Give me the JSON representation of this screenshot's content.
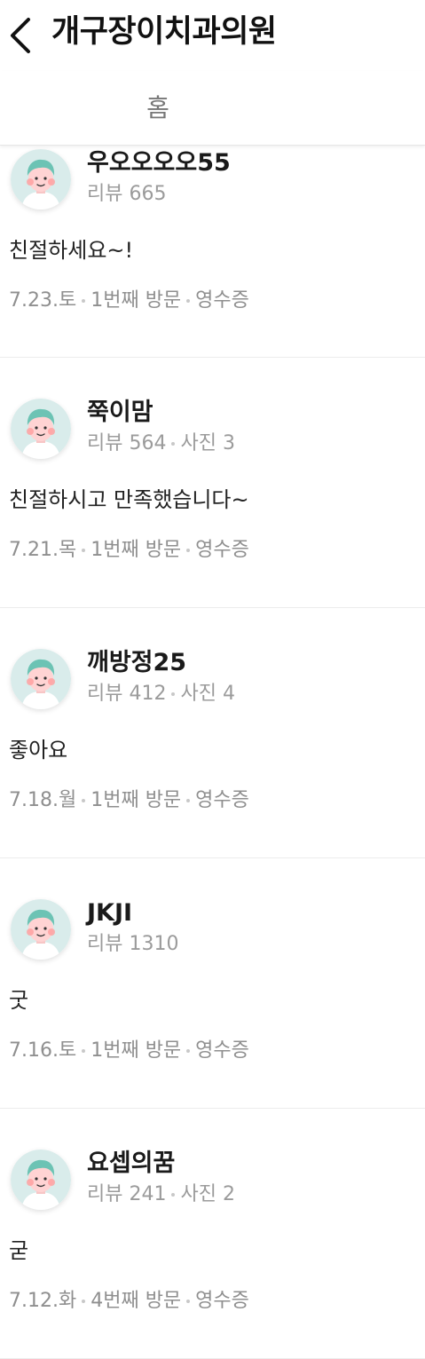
{
  "header": {
    "title": "개구장이치과의원"
  },
  "tabs": [
    {
      "label": "홈"
    }
  ],
  "reviews": [
    {
      "nickname": "우오오오오55",
      "review_count": "리뷰 665",
      "photo_count": "",
      "text": "친절하세요~!",
      "date": "7.23.토",
      "visit": "1번째 방문",
      "verify": "영수증"
    },
    {
      "nickname": "쭉이맘",
      "review_count": "리뷰 564",
      "photo_count": "사진 3",
      "text": "친절하시고 만족했습니다~",
      "date": "7.21.목",
      "visit": "1번째 방문",
      "verify": "영수증"
    },
    {
      "nickname": "깨방정25",
      "review_count": "리뷰 412",
      "photo_count": "사진 4",
      "text": "좋아요",
      "date": "7.18.월",
      "visit": "1번째 방문",
      "verify": "영수증"
    },
    {
      "nickname": "JKJI",
      "review_count": "리뷰 1310",
      "photo_count": "",
      "text": "굿",
      "date": "7.16.토",
      "visit": "1번째 방문",
      "verify": "영수증"
    },
    {
      "nickname": "요셉의꿈",
      "review_count": "리뷰 241",
      "photo_count": "사진 2",
      "text": "굳",
      "date": "7.12.화",
      "visit": "4번째 방문",
      "verify": "영수증"
    }
  ]
}
